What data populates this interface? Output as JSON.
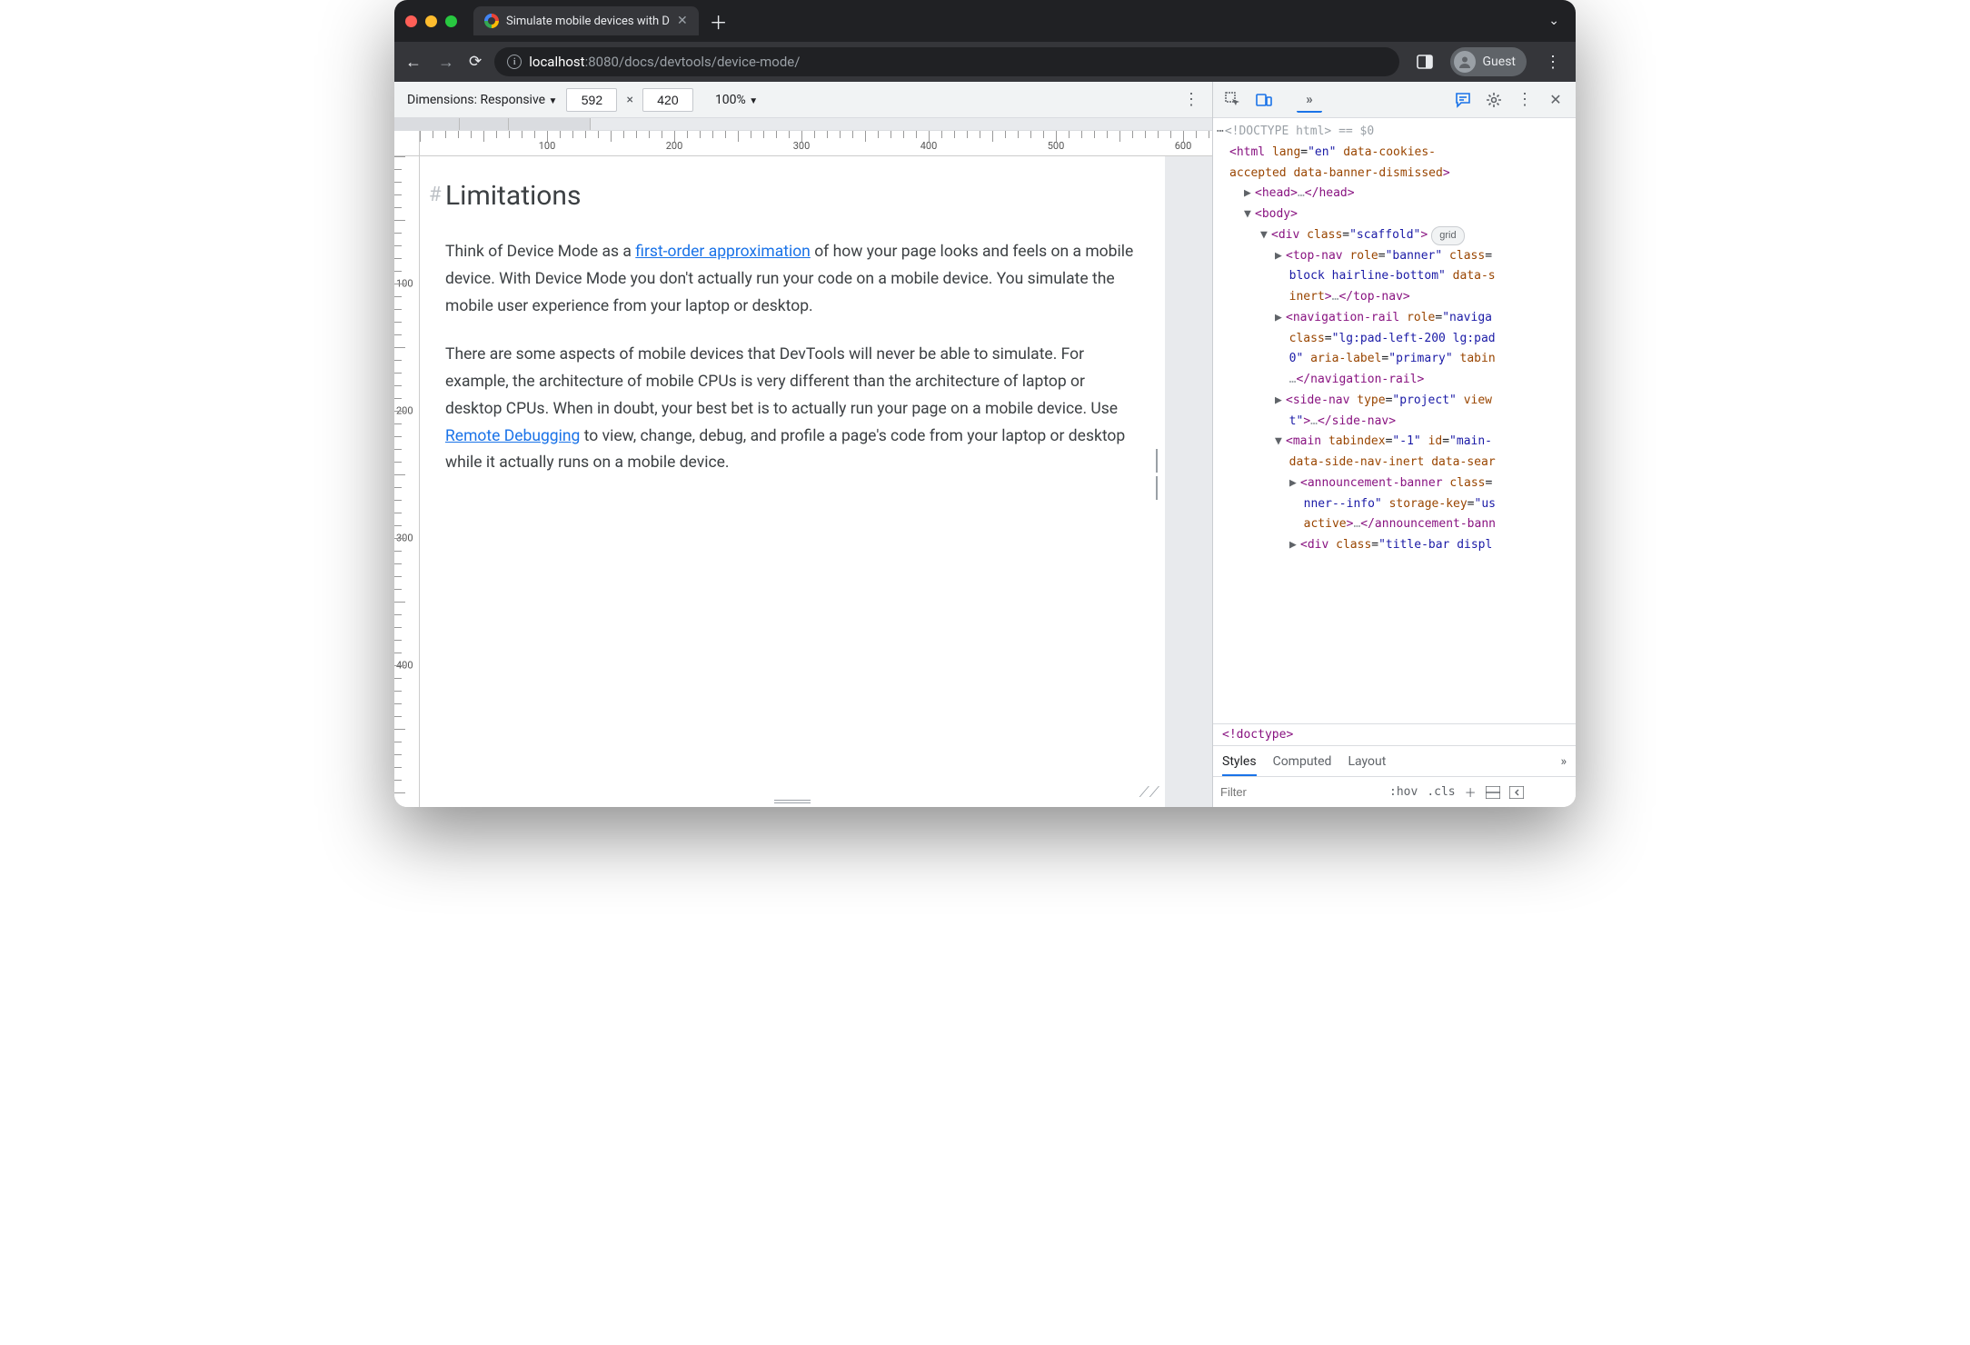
{
  "browser": {
    "tabTitle": "Simulate mobile devices with D",
    "url_host": "localhost",
    "url_port": ":8080",
    "url_path": "/docs/devtools/device-mode/",
    "guestLabel": "Guest"
  },
  "deviceToolbar": {
    "dimensionsLabel": "Dimensions: Responsive",
    "width": "592",
    "height": "420",
    "zoom": "100%"
  },
  "rulerH": [
    "100",
    "200",
    "300",
    "400",
    "500",
    "600"
  ],
  "rulerV": [
    "100",
    "200",
    "300",
    "400"
  ],
  "page": {
    "heading": "Limitations",
    "p1a": "Think of Device Mode as a ",
    "p1link": "first-order approximation",
    "p1b": " of how your page looks and feels on a mobile device. With Device Mode you don't actually run your code on a mobile device. You simulate the mobile user experience from your laptop or desktop.",
    "p2a": "There are some aspects of mobile devices that DevTools will never be able to simulate. For example, the architecture of mobile CPUs is very different than the architecture of laptop or desktop CPUs. When in doubt, your best bet is to actually run your page on a mobile device. Use ",
    "p2link": "Remote Debugging",
    "p2b": " to view, change, debug, and profile a page's code from your laptop or desktop while it actually runs on a mobile device."
  },
  "dom": {
    "doctype": "<!DOCTYPE html>",
    "eqDollar": "== $0",
    "htmlOpen1": "<html lang=\"en\" data-cookies-",
    "htmlOpen2": "accepted data-banner-dismissed>",
    "headOpen": "<head>",
    "headEll": "…",
    "headClose": "</head>",
    "bodyOpen": "<body>",
    "divScaffold": "<div class=\"scaffold\">",
    "gridPill": "grid",
    "topnav1": "<top-nav role=\"banner\" class=",
    "topnav2": "block hairline-bottom\" data-s",
    "topnav3": "inert>",
    "topnavEll": "…",
    "topnavClose": "</top-nav>",
    "navrail1": "<navigation-rail role=\"naviga",
    "navrail2": "class=\"lg:pad-left-200 lg:pad",
    "navrail3": "0\" aria-label=\"primary\" tabin",
    "navrailEll": "…",
    "navrailClose": "</navigation-rail>",
    "sidenav1": "<side-nav type=\"project\" view",
    "sidenav2": "t\">",
    "sidenavEll": "…",
    "sidenavClose": "</side-nav>",
    "main1": "<main tabindex=\"-1\" id=\"main-",
    "main2": "data-side-nav-inert data-sear",
    "ann1": "<announcement-banner class=",
    "ann2": "nner--info\" storage-key=\"us",
    "ann3": "active>",
    "annEll": "…",
    "annClose": "</announcement-bann",
    "titlebar": "<div class=\"title-bar displ"
  },
  "crumb": "<!doctype>",
  "stylesTabs": {
    "styles": "Styles",
    "computed": "Computed",
    "layout": "Layout"
  },
  "filter": {
    "placeholder": "Filter",
    "hov": ":hov",
    "cls": ".cls"
  }
}
